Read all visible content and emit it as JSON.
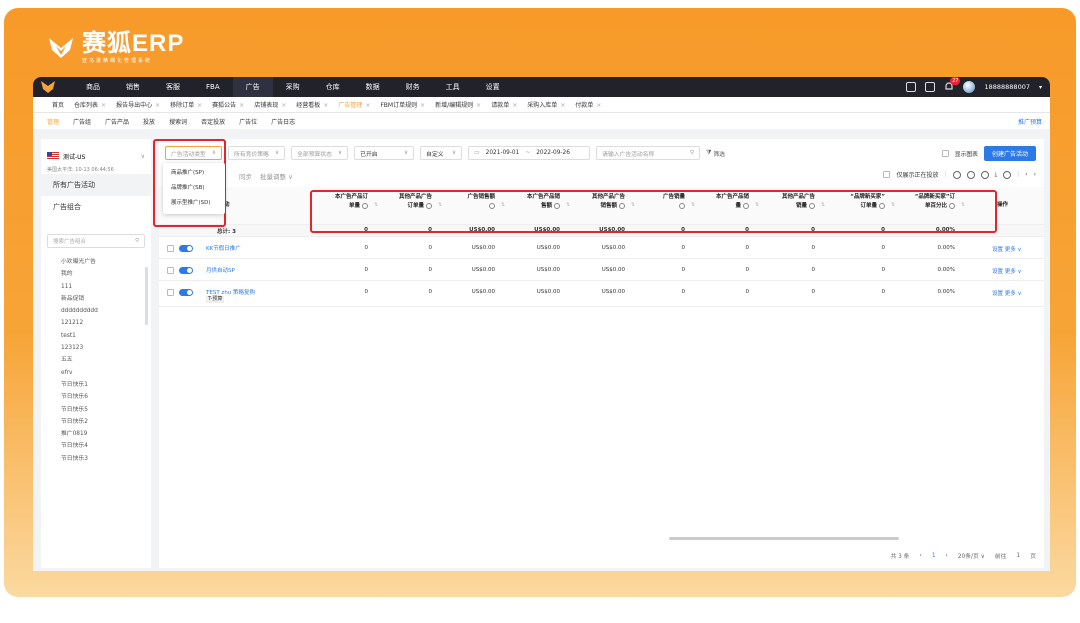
{
  "brand": {
    "title": "赛狐ERP",
    "subtitle": "亚马逊精细化管理系统"
  },
  "topnav": {
    "items": [
      "商品",
      "销售",
      "客服",
      "FBA",
      "广告",
      "采购",
      "仓库",
      "数据",
      "财务",
      "工具",
      "设置"
    ],
    "active_index": 4,
    "badge": "27",
    "user_phone": "18888888007"
  },
  "tabs": [
    "首页",
    "仓库列表",
    "报告导出中心",
    "移除订单",
    "赛狐公告",
    "店铺表现",
    "经营看板",
    "广告管理",
    "FBM订单规则",
    "新增/编辑规则",
    "请款单",
    "采购入库单",
    "付款单"
  ],
  "active_tab_index": 7,
  "subnav": {
    "items": [
      "管理",
      "广告组",
      "广告产品",
      "投放",
      "搜索词",
      "否定投放",
      "广告位",
      "广告日志"
    ],
    "active_index": 0,
    "right_link": "推广预算"
  },
  "sidebar": {
    "shop": "测试-US",
    "timezone": "美国太平洋: 10-13 06:44:56",
    "menu": [
      "所有广告活动",
      "广告组合"
    ],
    "search_placeholder": "搜索广告组合",
    "groups": [
      "小欢曝光广告",
      "我的",
      "111",
      "新品促销",
      "dddddddddd",
      "121212",
      "test1",
      "123123",
      "五五",
      "efrv",
      "节日快乐1",
      "节日快乐6",
      "节日快乐5",
      "节日快乐2",
      "推广0819",
      "节日快乐4",
      "节日快乐3"
    ]
  },
  "filters": {
    "ad_type": "广告活动类型",
    "strategy": "所有竞价策略",
    "budget": "全部预算状态",
    "status": "已开启",
    "custom": "自定义",
    "date_start": "2021-09-01",
    "date_sep": "~",
    "date_end": "2022-09-26",
    "search_placeholder": "请输入广告活动名称",
    "filter_label": "筛选",
    "show_chart": "显示图表",
    "create_button": "创建广告活动"
  },
  "dropdown": [
    "商品推广(SP)",
    "品牌推广(SB)",
    "展示型推广(SD)"
  ],
  "actions": {
    "sync": "同步",
    "bulk": "批量调整",
    "only_running": "仅展示正在投放"
  },
  "columns": [
    {
      "l1": "本广告产品订",
      "l2": "单量"
    },
    {
      "l1": "其他产品广告",
      "l2": "订单量"
    },
    {
      "l1": "广告销售额",
      "l2": ""
    },
    {
      "l1": "本广告产品销",
      "l2": "售额"
    },
    {
      "l1": "其他产品广告",
      "l2": "销售额"
    },
    {
      "l1": "广告销量",
      "l2": ""
    },
    {
      "l1": "本广告产品销",
      "l2": "量"
    },
    {
      "l1": "其他产品广告",
      "l2": "销量"
    },
    {
      "l1": "“品牌新买家”",
      "l2": "订单量"
    },
    {
      "l1": "“品牌新买家”订",
      "l2": "单百分比"
    }
  ],
  "header_action": "操作",
  "name_col_header": "动",
  "total": {
    "label": "总计: 3",
    "values": [
      "0",
      "0",
      "US$0.00",
      "US$0.00",
      "US$0.00",
      "0",
      "0",
      "0",
      "0",
      "0.00%"
    ]
  },
  "rows": [
    {
      "name": "KK节假日推广",
      "tag": "",
      "values": [
        "0",
        "0",
        "US$0.00",
        "US$0.00",
        "US$0.00",
        "0",
        "0",
        "0",
        "0",
        "0.00%"
      ]
    },
    {
      "name": "月供自动SP",
      "tag": "",
      "values": [
        "0",
        "0",
        "US$0.00",
        "US$0.00",
        "US$0.00",
        "0",
        "0",
        "0",
        "0",
        "0.00%"
      ]
    },
    {
      "name": "TEST zhu 策略复购",
      "tag": "T-预算",
      "values": [
        "0",
        "0",
        "US$0.00",
        "US$0.00",
        "US$0.00",
        "0",
        "0",
        "0",
        "0",
        "0.00%"
      ]
    }
  ],
  "row_ops": {
    "setting": "设置",
    "more": "更多"
  },
  "pager": {
    "total": "共 3 条",
    "page": "1",
    "per_page": "20条/页",
    "goto": "前往",
    "goto_page": "1",
    "page_suffix": "页"
  }
}
